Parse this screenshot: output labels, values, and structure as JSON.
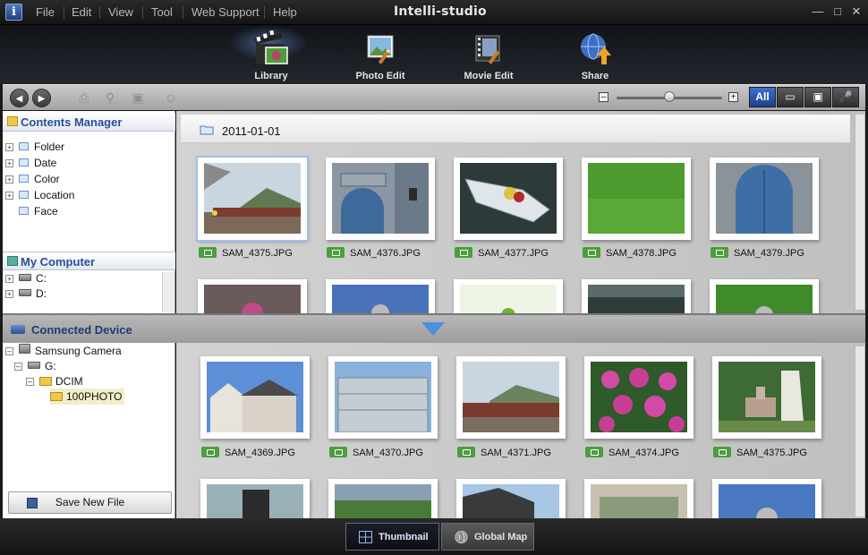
{
  "titlebar": {
    "app_title": "Intelli-studio",
    "menu": [
      "File",
      "Edit",
      "View",
      "Tool",
      "Web Support",
      "Help"
    ],
    "window_controls": [
      "minimize",
      "maximize",
      "close"
    ]
  },
  "modes": [
    {
      "label": "Library",
      "icon": "film-clapper-icon",
      "active": true
    },
    {
      "label": "Photo Edit",
      "icon": "photo-edit-icon",
      "active": false
    },
    {
      "label": "Movie Edit",
      "icon": "movie-edit-icon",
      "active": false
    },
    {
      "label": "Share",
      "icon": "globe-share-icon",
      "active": false
    }
  ],
  "toolbar": {
    "filters": [
      {
        "label": "All",
        "active": true
      },
      {
        "label": "▭",
        "icon": "video-filter-icon",
        "active": false
      },
      {
        "label": "▣",
        "icon": "photo-filter-icon",
        "active": false
      },
      {
        "label": "🎤",
        "icon": "audio-filter-icon",
        "active": false
      }
    ],
    "zoom_level": 0.5
  },
  "contents_manager": {
    "title": "Contents Manager",
    "items": [
      "Folder",
      "Date",
      "Color",
      "Location",
      "Face"
    ]
  },
  "my_computer": {
    "title": "My Computer",
    "drives": [
      "C:",
      "D:"
    ]
  },
  "main": {
    "folder_title": "2011-01-01",
    "files": [
      "SAM_4375.JPG",
      "SAM_4376.JPG",
      "SAM_4377.JPG",
      "SAM_4378.JPG",
      "SAM_4379.JPG"
    ]
  },
  "connected_device": {
    "title": "Connected Device",
    "tree": {
      "device": "Samsung Camera",
      "drive": "G:",
      "folder": "DCIM",
      "subfolder": "100PHOTO"
    },
    "save_label": "Save New File",
    "files": [
      "SAM_4369.JPG",
      "SAM_4370.JPG",
      "SAM_4371.JPG",
      "SAM_4374.JPG",
      "SAM_4375.JPG"
    ]
  },
  "statusbar": {
    "thumbnail_label": "Thumbnail",
    "map_label": "Global Map"
  },
  "colors": {
    "accent": "#2a4e9a",
    "badge": "#4c9d3c",
    "active_filter": "#3c6fd0"
  }
}
